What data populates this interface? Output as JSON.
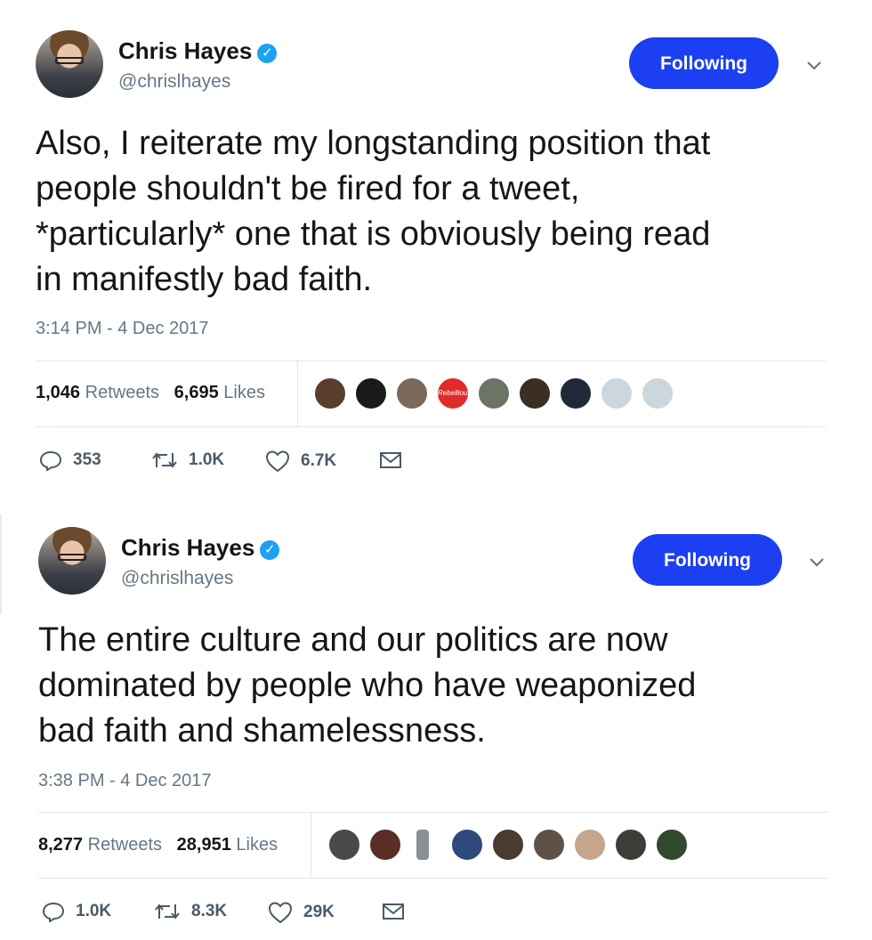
{
  "tweets": [
    {
      "author": "Chris Hayes",
      "handle": "@chrislhayes",
      "follow_label": "Following",
      "lines": [
        "Also, I reiterate my longstanding position that",
        "people shouldn't be fired for a tweet,",
        "*particularly* one that is obviously being read",
        "in manifestly bad faith."
      ],
      "timestamp": "3:14 PM - 4 Dec 2017",
      "retweets": "1,046",
      "retweets_label": "Retweets",
      "likes": "6,695",
      "likes_label": "Likes",
      "liker_label": "Rebellious",
      "replies_count": "353",
      "retweet_count": "1.0K",
      "like_count": "6.7K"
    },
    {
      "author": "Chris Hayes",
      "handle": "@chrislhayes",
      "follow_label": "Following",
      "lines": [
        "The entire culture and our politics are now",
        "dominated by people who have weaponized",
        "bad faith and shamelessness."
      ],
      "timestamp": "3:38 PM - 4 Dec 2017",
      "retweets": "8,277",
      "retweets_label": "Retweets",
      "likes": "28,951",
      "likes_label": "Likes",
      "replies_count": "1.0K",
      "retweet_count": "8.3K",
      "like_count": "29K"
    }
  ],
  "icons": {
    "verified": "verified-badge-icon",
    "caret": "chevron-down-icon",
    "reply": "reply-icon",
    "retweet": "retweet-icon",
    "like": "heart-icon",
    "dm": "envelope-icon"
  },
  "colors": {
    "follow_button": "#1c3ff2",
    "verified": "#1da1f2",
    "muted_text": "#657786"
  }
}
